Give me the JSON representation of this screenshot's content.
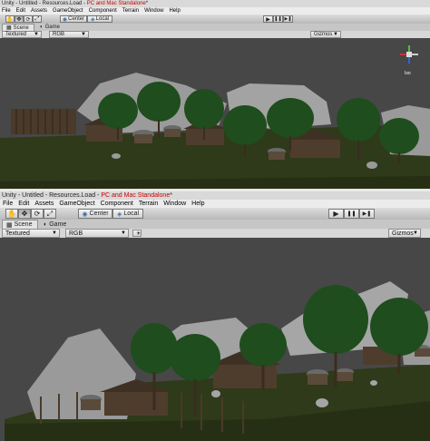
{
  "windows": [
    {
      "title_prefix": "Unity - Untitled - Resources.Load - ",
      "title_platform": "PC and Mac Standalone",
      "title_suffix": "*",
      "menu": [
        "File",
        "Edit",
        "Assets",
        "GameObject",
        "Component",
        "Terrain",
        "Window",
        "Help"
      ],
      "toolbar": {
        "center_label": "Center",
        "local_label": "Local",
        "play_icon": "▶",
        "pause_icon": "❚❚",
        "step_icon": "▶❚"
      },
      "tabs": {
        "scene": "Scene",
        "game": "Game"
      },
      "controls": {
        "render_mode": "Textured",
        "color_mode": "RGB",
        "gizmos": "Gizmos"
      },
      "scene_label": "Iso"
    },
    {
      "title_prefix": "Unity - Untitled - Resources.Load - ",
      "title_platform": "PC and Mac Standalone",
      "title_suffix": "*",
      "menu": [
        "File",
        "Edit",
        "Assets",
        "GameObject",
        "Component",
        "Terrain",
        "Window",
        "Help"
      ],
      "toolbar": {
        "center_label": "Center",
        "local_label": "Local",
        "play_icon": "▶",
        "pause_icon": "❚❚",
        "step_icon": "▶❚"
      },
      "tabs": {
        "scene": "Scene",
        "game": "Game"
      },
      "controls": {
        "render_mode": "Textured",
        "color_mode": "RGB",
        "gizmos": "Gizmos"
      }
    }
  ],
  "colors": {
    "title_platform": "#cc0000",
    "sky": "#474747",
    "grass": "#2e3a19",
    "tree": "#1f4d1e",
    "rock": "#9d9d9d"
  }
}
